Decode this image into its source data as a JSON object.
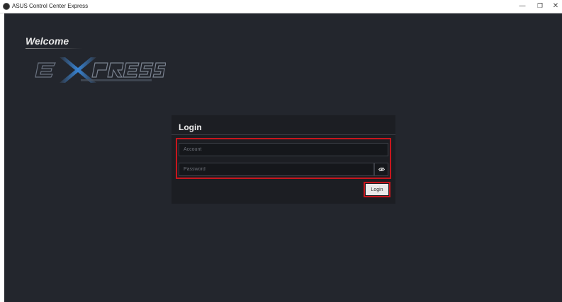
{
  "window": {
    "title": "ASUS Control Center Express",
    "controls": {
      "minimize": "—",
      "maximize": "❐",
      "close": "✕"
    }
  },
  "welcome": {
    "text": "Welcome"
  },
  "logo": {
    "name": "express-logo"
  },
  "login": {
    "title": "Login",
    "account_placeholder": "Account",
    "account_value": "",
    "password_placeholder": "Password",
    "password_value": "",
    "submit_label": "Login"
  },
  "colors": {
    "background": "#23262d",
    "panel": "#1c1e23",
    "highlight": "#c8161d",
    "logo_blue": "#3a8ee6"
  },
  "icons": {
    "app": "asus-app-icon",
    "show_password": "eye-icon"
  }
}
